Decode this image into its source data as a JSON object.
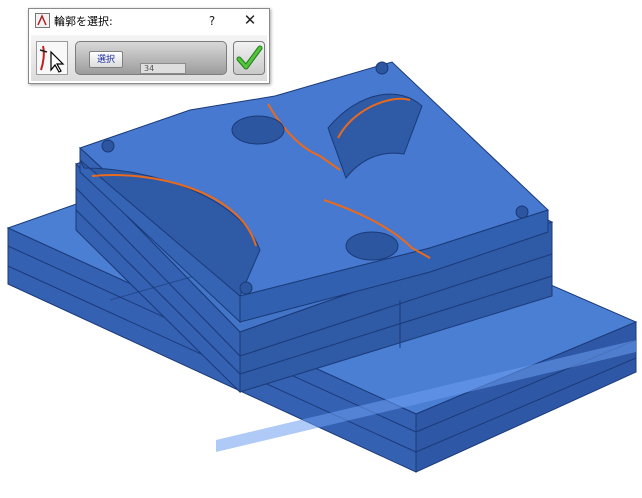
{
  "dialog": {
    "title": "輪郭を選択:",
    "help_label": "?",
    "close_label": "✕",
    "select_button_label": "選択",
    "count_value": "34",
    "icons": {
      "title": "app-icon",
      "tool": "select-tool-icon",
      "ok": "checkmark-icon"
    }
  },
  "viewport": {
    "model_color": "#3d6fc2",
    "highlight_color": "#e86a1e"
  }
}
